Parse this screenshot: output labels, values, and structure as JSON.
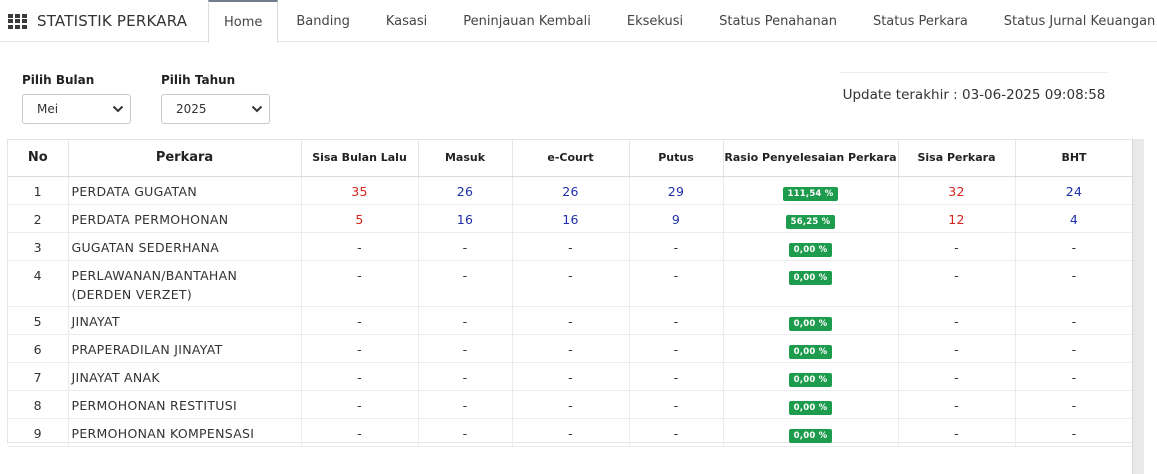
{
  "app": {
    "title": "STATISTIK PERKARA",
    "menu_icon": "grid-icon"
  },
  "nav": {
    "items": [
      {
        "label": "Home",
        "active": true
      },
      {
        "label": "Banding",
        "active": false
      },
      {
        "label": "Kasasi",
        "active": false
      },
      {
        "label": "Peninjauan Kembali",
        "active": false
      },
      {
        "label": "Eksekusi",
        "active": false
      },
      {
        "label": "Status Penahanan",
        "active": false
      },
      {
        "label": "Status Perkara",
        "active": false
      },
      {
        "label": "Status Jurnal Keuangan Perdata",
        "active": false
      }
    ]
  },
  "filters": {
    "month_label": "Pilih Bulan",
    "month_value": "Mei",
    "year_label": "Pilih Tahun",
    "year_value": "2025"
  },
  "update_text": "Update terakhir : 03-06-2025 09:08:58",
  "table": {
    "headers": {
      "no": "No",
      "perkara": "Perkara",
      "sisa_bulan_lalu": "Sisa Bulan Lalu",
      "masuk": "Masuk",
      "ecourt": "e-Court",
      "putus": "Putus",
      "rasio": "Rasio Penyelesaian Perkara",
      "sisa_perkara": "Sisa Perkara",
      "bht": "BHT"
    },
    "rows": [
      {
        "no": "1",
        "perkara": "PERDATA GUGATAN",
        "sisa_bulan_lalu": "35",
        "masuk": "26",
        "ecourt": "26",
        "putus": "29",
        "rasio": "111,54 %",
        "sisa_perkara": "32",
        "bht": "24"
      },
      {
        "no": "2",
        "perkara": "PERDATA PERMOHONAN",
        "sisa_bulan_lalu": "5",
        "masuk": "16",
        "ecourt": "16",
        "putus": "9",
        "rasio": "56,25 %",
        "sisa_perkara": "12",
        "bht": "4"
      },
      {
        "no": "3",
        "perkara": "GUGATAN SEDERHANA",
        "sisa_bulan_lalu": "-",
        "masuk": "-",
        "ecourt": "-",
        "putus": "-",
        "rasio": "0,00 %",
        "sisa_perkara": "-",
        "bht": "-"
      },
      {
        "no": "4",
        "perkara": "PERLAWANAN/BANTAHAN (DERDEN VERZET)",
        "sisa_bulan_lalu": "-",
        "masuk": "-",
        "ecourt": "-",
        "putus": "-",
        "rasio": "0,00 %",
        "sisa_perkara": "-",
        "bht": "-"
      },
      {
        "no": "5",
        "perkara": "JINAYAT",
        "sisa_bulan_lalu": "-",
        "masuk": "-",
        "ecourt": "-",
        "putus": "-",
        "rasio": "0,00 %",
        "sisa_perkara": "-",
        "bht": "-"
      },
      {
        "no": "6",
        "perkara": "PRAPERADILAN JINAYAT",
        "sisa_bulan_lalu": "-",
        "masuk": "-",
        "ecourt": "-",
        "putus": "-",
        "rasio": "0,00 %",
        "sisa_perkara": "-",
        "bht": "-"
      },
      {
        "no": "7",
        "perkara": "JINAYAT ANAK",
        "sisa_bulan_lalu": "-",
        "masuk": "-",
        "ecourt": "-",
        "putus": "-",
        "rasio": "0,00 %",
        "sisa_perkara": "-",
        "bht": "-"
      },
      {
        "no": "8",
        "perkara": "PERMOHONAN RESTITUSI",
        "sisa_bulan_lalu": "-",
        "masuk": "-",
        "ecourt": "-",
        "putus": "-",
        "rasio": "0,00 %",
        "sisa_perkara": "-",
        "bht": "-"
      },
      {
        "no": "9",
        "perkara": "PERMOHONAN KOMPENSASI",
        "sisa_bulan_lalu": "-",
        "masuk": "-",
        "ecourt": "-",
        "putus": "-",
        "rasio": "0,00 %",
        "sisa_perkara": "-",
        "bht": "-"
      }
    ]
  },
  "colors": {
    "badge_green": "#1e9c4d",
    "value_red": "#d9231d",
    "value_blue": "#1f2fa8"
  }
}
